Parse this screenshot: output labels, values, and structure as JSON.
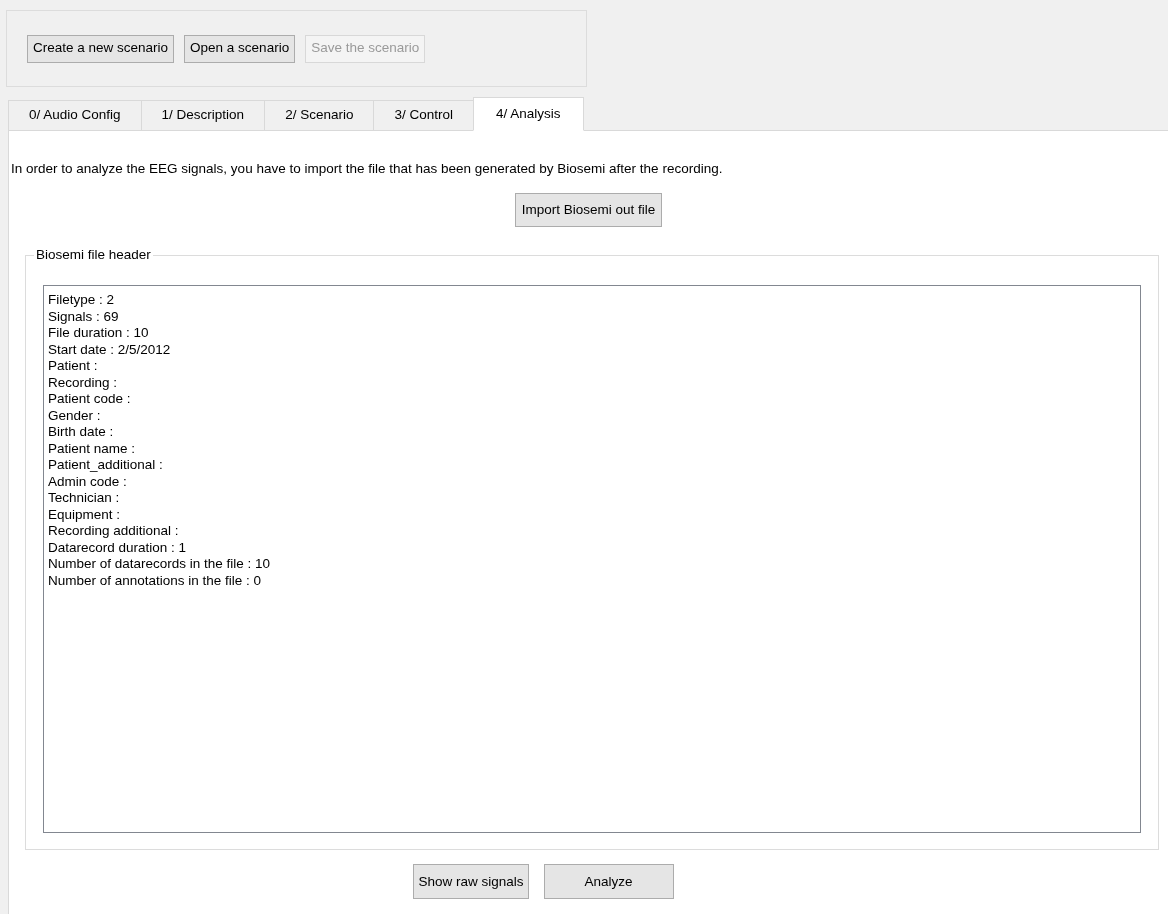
{
  "toolbar": {
    "buttons": [
      {
        "label": "Create a new scenario",
        "disabled": false
      },
      {
        "label": "Open a scenario",
        "disabled": false
      },
      {
        "label": "Save the scenario",
        "disabled": true
      }
    ]
  },
  "tabs": [
    {
      "label": "0/ Audio Config",
      "selected": false
    },
    {
      "label": "1/ Description",
      "selected": false
    },
    {
      "label": "2/ Scenario",
      "selected": false
    },
    {
      "label": "3/ Control",
      "selected": false
    },
    {
      "label": "4/ Analysis",
      "selected": true
    }
  ],
  "analysis": {
    "instructions": "In order to analyze the EEG signals, you have to import the file that has been generated by Biosemi after the recording.",
    "import_button": "Import Biosemi out file",
    "header_group": {
      "title": "Biosemi file header",
      "lines": [
        "Filetype : 2",
        "Signals : 69",
        "File duration : 10",
        "Start date : 2/5/2012",
        "Patient :",
        "Recording :",
        "Patient code :",
        "Gender :",
        "Birth date :",
        "Patient name :",
        "Patient_additional :",
        "Admin code :",
        "Technician :",
        "Equipment :",
        "Recording additional :",
        "Datarecord duration : 1",
        "Number of datarecords in the file : 10",
        "Number of annotations in the file : 0"
      ]
    },
    "buttons": [
      "Show raw signals",
      "Analyze"
    ]
  }
}
